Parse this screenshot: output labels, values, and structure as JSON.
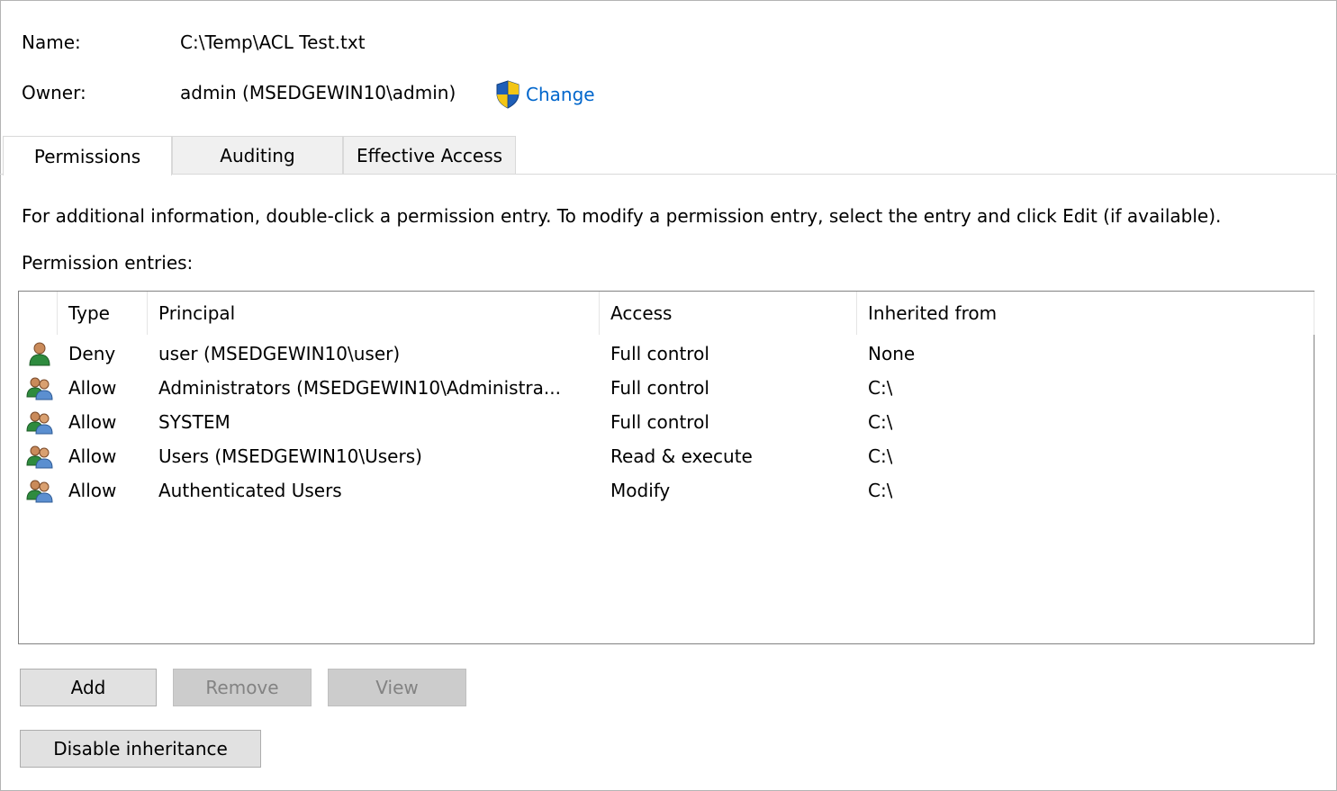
{
  "header": {
    "name_label": "Name:",
    "name_value": "C:\\Temp\\ACL Test.txt",
    "owner_label": "Owner:",
    "owner_value": "admin (MSEDGEWIN10\\admin)",
    "change_link": "Change",
    "change_icon": "uac-shield-icon"
  },
  "tabs": [
    {
      "label": "Permissions",
      "active": true
    },
    {
      "label": "Auditing",
      "active": false
    },
    {
      "label": "Effective Access",
      "active": false
    }
  ],
  "info_text": "For additional information, double-click a permission entry. To modify a permission entry, select the entry and click Edit (if available).",
  "entries_label": "Permission entries:",
  "columns": [
    "Type",
    "Principal",
    "Access",
    "Inherited from"
  ],
  "entries": [
    {
      "icon": "single-user-icon",
      "type": "Deny",
      "principal": "user (MSEDGEWIN10\\user)",
      "access": "Full control",
      "inherited": "None"
    },
    {
      "icon": "user-group-icon",
      "type": "Allow",
      "principal": "Administrators (MSEDGEWIN10\\Administra...",
      "access": "Full control",
      "inherited": "C:\\"
    },
    {
      "icon": "user-group-icon",
      "type": "Allow",
      "principal": "SYSTEM",
      "access": "Full control",
      "inherited": "C:\\"
    },
    {
      "icon": "user-group-icon",
      "type": "Allow",
      "principal": "Users (MSEDGEWIN10\\Users)",
      "access": "Read & execute",
      "inherited": "C:\\"
    },
    {
      "icon": "user-group-icon",
      "type": "Allow",
      "principal": "Authenticated Users",
      "access": "Modify",
      "inherited": "C:\\"
    }
  ],
  "buttons": {
    "add": "Add",
    "remove": "Remove",
    "view": "View",
    "disable_inheritance": "Disable inheritance"
  },
  "colors": {
    "link": "#0066cc",
    "disabled_text": "#838383",
    "tab_inactive_bg": "#f0f0f0"
  }
}
